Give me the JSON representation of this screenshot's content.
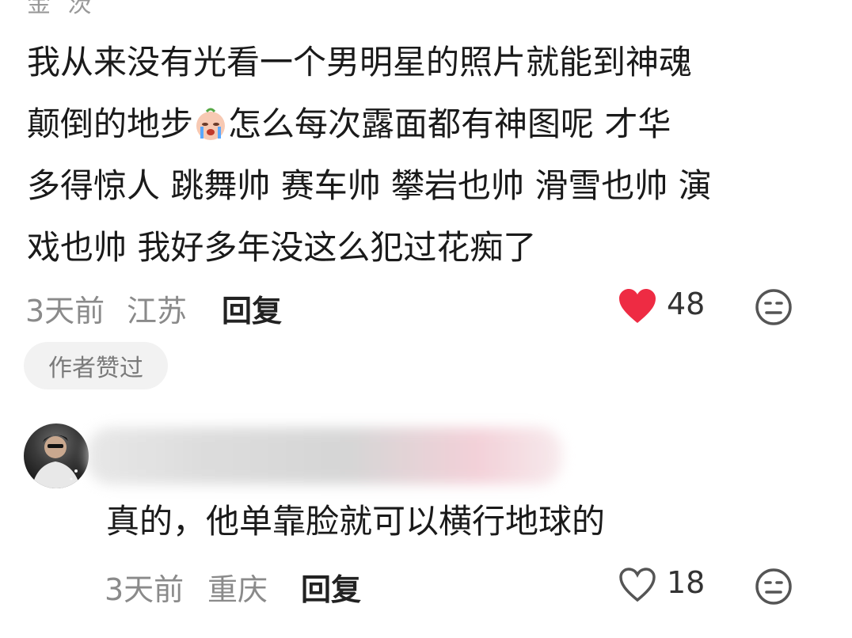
{
  "top_fragment": "金 茨",
  "comment": {
    "text_line1": "我从来没有光看一个男明星的照片就能到神魂",
    "text_line2a": "颠倒的地步",
    "text_line2b": "怎么每次露面都有神图呢 才华",
    "text_line3": "多得惊人 跳舞帅 赛车帅 攀岩也帅 滑雪也帅 演",
    "text_line4": "戏也帅 我好多年没这么犯过花痴了",
    "time": "3天前",
    "location": "江苏",
    "reply_label": "回复",
    "likes": "48",
    "liked": true,
    "badge": "作者赞过"
  },
  "reply": {
    "text": "真的，他单靠脸就可以横行地球的",
    "time": "3天前",
    "location": "重庆",
    "reply_label": "回复",
    "likes": "18",
    "liked": false
  },
  "colors": {
    "like_red": "#ee2b43",
    "meta_gray": "#8a8a8a"
  },
  "icons": [
    "crying-emoji-icon",
    "heart-filled-icon",
    "heart-outline-icon",
    "meh-face-icon",
    "avatar-image"
  ]
}
